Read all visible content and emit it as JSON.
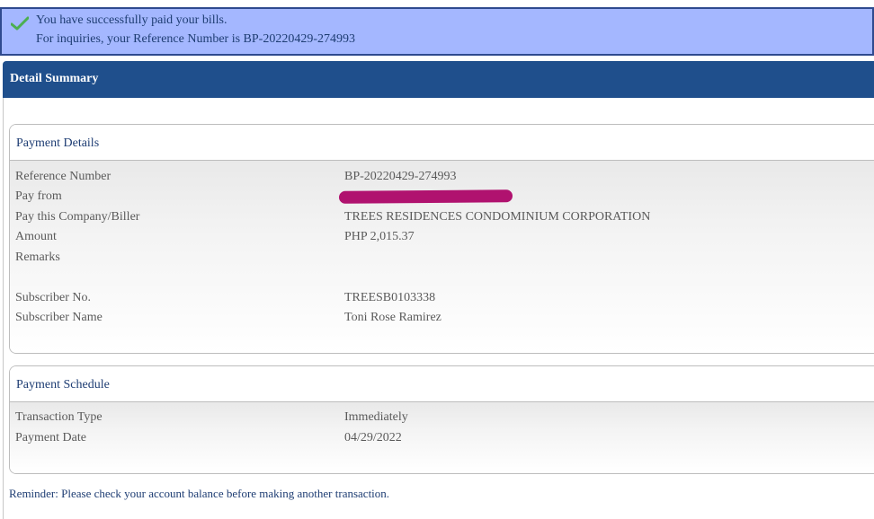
{
  "banner": {
    "line1": "You have successfully paid your bills.",
    "line2": "For inquiries, your Reference Number is BP-20220429-274993",
    "check_color": "#4caf50"
  },
  "summary": {
    "title": "Detail Summary"
  },
  "payment_details": {
    "title": "Payment Details",
    "rows": [
      {
        "label": "Reference Number",
        "value": "BP-20220429-274993"
      },
      {
        "label": "Pay from",
        "value": ""
      },
      {
        "label": "Pay this Company/Biller",
        "value": "TREES RESIDENCES CONDOMINIUM CORPORATION"
      },
      {
        "label": "Amount",
        "value": "PHP 2,015.37"
      },
      {
        "label": "Remarks",
        "value": ""
      },
      {
        "label": "Subscriber No.",
        "value": "TREESB0103338"
      },
      {
        "label": "Subscriber Name",
        "value": "Toni Rose Ramirez"
      }
    ]
  },
  "payment_schedule": {
    "title": "Payment Schedule",
    "rows": [
      {
        "label": "Transaction Type",
        "value": "Immediately"
      },
      {
        "label": "Payment Date",
        "value": "04/29/2022"
      }
    ]
  },
  "reminder": "Reminder: Please check your account balance before making another transaction.",
  "colors": {
    "banner_bg": "#a4b7ff",
    "header_bg": "#1f4f8c",
    "redaction": "#b0126f"
  }
}
